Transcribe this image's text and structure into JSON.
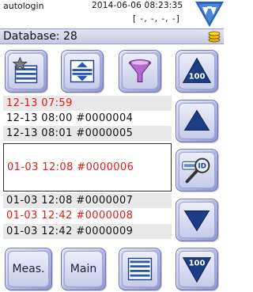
{
  "status": {
    "user": "autologin",
    "datetime": "2014-06-06  08:23:35",
    "coords": "[ -, -, -, -]"
  },
  "title": {
    "database_label": "Database: 28"
  },
  "buttons": {
    "meas_label": "Meas.",
    "main_label": "Main",
    "page_up_label": "100",
    "page_down_label": "100"
  },
  "records": [
    {
      "text": "12-13  07:59",
      "color": "red"
    },
    {
      "text": "12-13  08:00  #0000004",
      "color": "black"
    },
    {
      "text": "12-13  08:01  #0000005",
      "color": "black"
    },
    {
      "text": "01-03  12:08  #0000006",
      "color": "red",
      "selected": true
    },
    {
      "text": "01-03  12:08  #0000007",
      "color": "black"
    },
    {
      "text": "01-03  12:42  #0000008",
      "color": "red"
    },
    {
      "text": "01-03  12:42  #0000009",
      "color": "black"
    }
  ],
  "colors": {
    "accent": "#1f4fa0",
    "highlight_red": "#e11919",
    "button_face": "#c6cbea"
  },
  "icons": {
    "favorite_list": "star-list-icon",
    "sort": "sort-updown-icon",
    "filter": "funnel-icon",
    "page_up": "triangle-up-100-icon",
    "up": "triangle-up-icon",
    "search_id": "magnifier-id-icon",
    "down": "triangle-down-icon",
    "page_down": "triangle-down-100-icon",
    "list": "list-icon",
    "database": "coin-stack-icon",
    "logo": "brand-logo-icon"
  }
}
